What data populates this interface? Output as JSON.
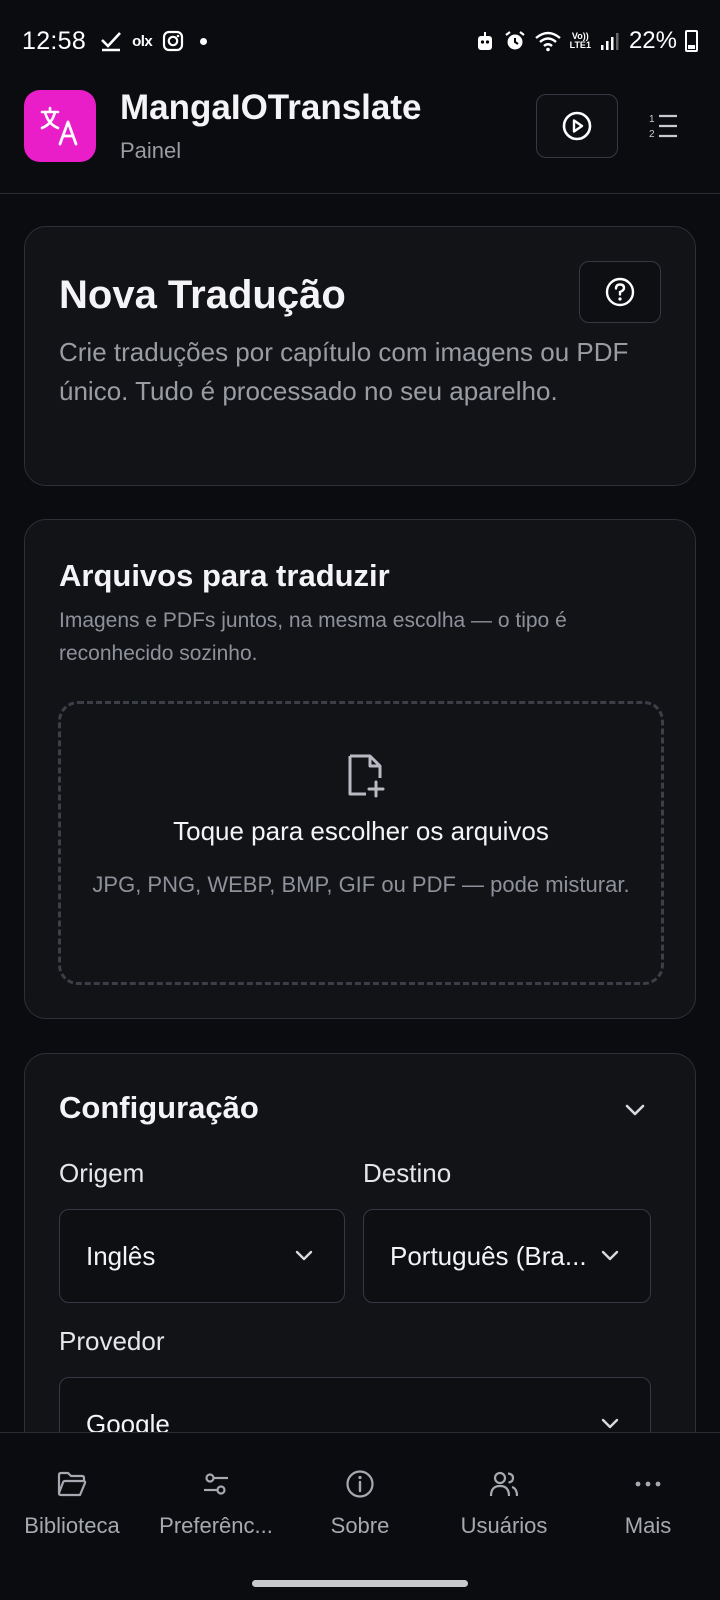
{
  "status_bar": {
    "time": "12:58",
    "olx_label": "olx",
    "battery": "22%",
    "network_label_top": "Vo))",
    "network_label_bottom": "LTE1",
    "icons": [
      "check-icon",
      "olx-icon",
      "instagram-icon",
      "notification-dot",
      "robot-icon",
      "alarm-icon",
      "wifi-icon",
      "signal-icon",
      "battery-icon"
    ]
  },
  "app_bar": {
    "title": "MangaIOTranslate",
    "subtitle": "Painel",
    "logo_color": "#e91ec8",
    "icons": [
      "translate-icon",
      "play-icon",
      "ordered-list-icon"
    ]
  },
  "new_translation": {
    "title": "Nova Tradução",
    "description": "Crie traduções por capítulo com imagens ou PDF único. Tudo é processado no seu aparelho.",
    "icon": "help-icon"
  },
  "files": {
    "title": "Arquivos para traduzir",
    "description": "Imagens e PDFs juntos, na mesma escolha — o tipo é reconhecido sozinho.",
    "dropzone_title": "Toque para escolher os arquivos",
    "dropzone_hint": "JPG, PNG, WEBP, BMP, GIF ou PDF — pode misturar.",
    "icon": "file-plus-icon"
  },
  "config": {
    "title": "Configuração",
    "source_label": "Origem",
    "source_value": "Inglês",
    "target_label": "Destino",
    "target_value": "Português (Bra...",
    "provider_label": "Provedor",
    "provider_value": "Google",
    "icon": "chevron-down-icon"
  },
  "bottom_nav": {
    "items": [
      {
        "label": "Biblioteca",
        "icon": "folder-icon"
      },
      {
        "label": "Preferênc...",
        "icon": "sliders-icon"
      },
      {
        "label": "Sobre",
        "icon": "info-icon"
      },
      {
        "label": "Usuários",
        "icon": "users-icon"
      },
      {
        "label": "Mais",
        "icon": "more-icon"
      }
    ]
  }
}
